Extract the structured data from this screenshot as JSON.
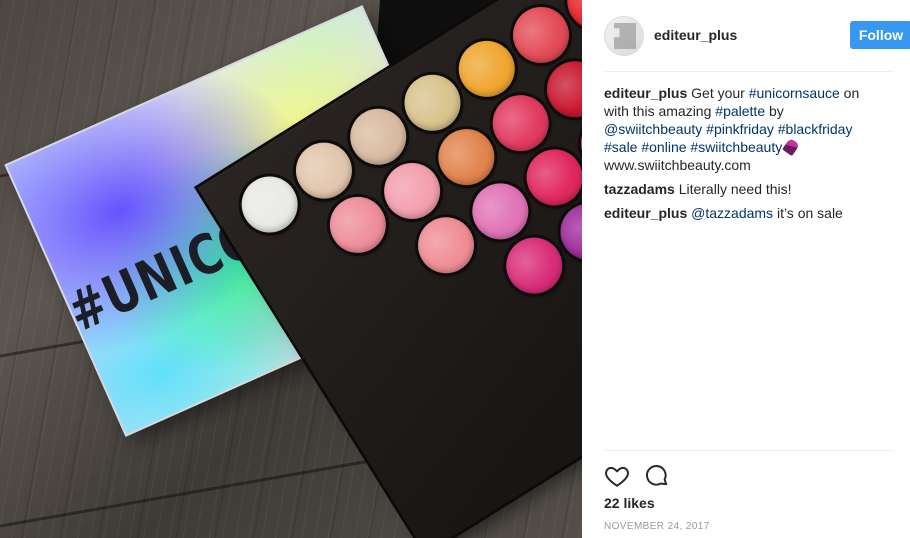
{
  "post": {
    "image_text": "#UNICORNSAUCE",
    "palette_colors": [
      [
        "#e9e9e7"
      ],
      [
        "#e2c6ad",
        "#ee8e9b"
      ],
      [
        "#d9bba1",
        "#f39fae",
        "#f08d95"
      ],
      [
        "#d7c38c",
        "#e2844d",
        "#e173b7",
        "#d92d78"
      ],
      [
        "#f0a632",
        "#e23a60",
        "#e0285d",
        "#9f2b9b",
        "#3bbf5c"
      ],
      [
        "#e34b56",
        "#c9172f",
        "#d72396",
        "#8c2ea9",
        "#2eae69",
        "#1f8e4a"
      ],
      [
        "#e5252b",
        "#f01f86",
        "#24b29a",
        "#8e3fb4",
        "#1e9aa0"
      ],
      [
        "#a51a5c",
        "#1b9784",
        "#5a1bb7"
      ]
    ]
  },
  "header": {
    "username": "editeur_plus",
    "follow_label": "Follow",
    "avatar_icon": "brand-logo-icon"
  },
  "comments": [
    {
      "user": "editeur_plus",
      "parts": [
        {
          "t": "text",
          "v": " Get your "
        },
        {
          "t": "tag",
          "v": "#unicornsauce"
        },
        {
          "t": "text",
          "v": " on with this amazing "
        },
        {
          "t": "tag",
          "v": "#palette"
        },
        {
          "t": "text",
          "v": " by "
        },
        {
          "t": "tag",
          "v": "@swiitchbeauty"
        },
        {
          "t": "text",
          "v": " "
        },
        {
          "t": "tag",
          "v": "#pinkfriday"
        },
        {
          "t": "text",
          "v": " "
        },
        {
          "t": "tag",
          "v": "#blackfriday"
        },
        {
          "t": "text",
          "v": " "
        },
        {
          "t": "tag",
          "v": "#sale"
        },
        {
          "t": "text",
          "v": " "
        },
        {
          "t": "tag",
          "v": "#online"
        },
        {
          "t": "text",
          "v": " "
        },
        {
          "t": "tag",
          "v": "#swiitchbeauty"
        },
        {
          "t": "emoji",
          "v": "lipstick-icon"
        },
        {
          "t": "text",
          "v": " www.swiitchbeauty.com"
        }
      ]
    },
    {
      "user": "tazzadams",
      "parts": [
        {
          "t": "text",
          "v": " Literally need this!"
        }
      ]
    },
    {
      "user": "editeur_plus",
      "parts": [
        {
          "t": "tag",
          "v": " @tazzadams"
        },
        {
          "t": "text",
          "v": " it’s on sale"
        }
      ]
    }
  ],
  "actions": {
    "like_icon": "heart-icon",
    "comment_icon": "comment-bubble-icon",
    "likes_label": "22 likes",
    "date": "NOVEMBER 24, 2017"
  },
  "colors": {
    "follow_bg": "#3897f0",
    "tag": "#003569",
    "meta": "#999999"
  }
}
